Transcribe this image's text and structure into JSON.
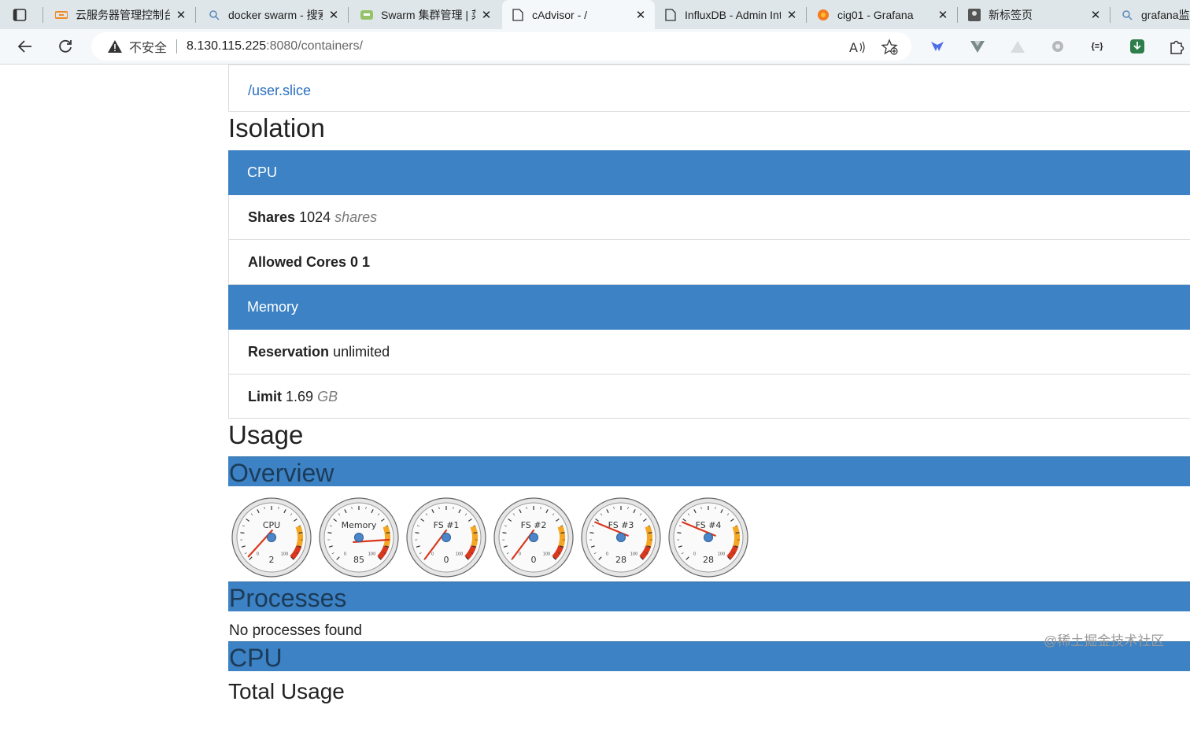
{
  "browser": {
    "tabs": [
      {
        "title": "云服务器管理控制台",
        "icon": "aliyun-icon",
        "close": "✕"
      },
      {
        "title": "docker swarm - 搜索",
        "icon": "search-icon",
        "close": "✕"
      },
      {
        "title": "Swarm 集群管理 | 菜鸟",
        "icon": "runoob-icon",
        "close": "✕"
      },
      {
        "title": "cAdvisor - /",
        "icon": "page-icon",
        "close": "✕"
      },
      {
        "title": "InfluxDB - Admin Interface",
        "icon": "page-icon",
        "close": "✕"
      },
      {
        "title": "cig01 - Grafana",
        "icon": "grafana-icon",
        "close": "✕"
      },
      {
        "title": "新标签页",
        "icon": "newtab-icon",
        "close": "✕"
      },
      {
        "title": "grafana监控",
        "icon": "search-icon",
        "close": ""
      }
    ],
    "security_label": "不安全",
    "url_host": "8.130.115.225",
    "url_rest": ":8080/containers/",
    "extensions": [
      "extension-blue-icon",
      "extension-vue-icon",
      "extension-triangle-icon",
      "extension-gear-icon",
      "extension-json-icon",
      "extension-download-icon",
      "extensions-puzzle-icon"
    ],
    "json_ext_label": "{≡}"
  },
  "page": {
    "subcontainer_link": "/user.slice",
    "isolation_title": "Isolation",
    "cpu_panel": {
      "heading": "CPU",
      "shares_label": "Shares",
      "shares_value": "1024",
      "shares_unit": "shares",
      "cores_label": "Allowed Cores",
      "cores_value": "0 1"
    },
    "memory_panel": {
      "heading": "Memory",
      "reservation_label": "Reservation",
      "reservation_value": "unlimited",
      "limit_label": "Limit",
      "limit_value": "1.69",
      "limit_unit": "GB"
    },
    "usage_title": "Usage",
    "overview_heading": "Overview",
    "gauges": [
      {
        "label": "CPU",
        "value": 2,
        "min_label": "0",
        "max_label": "100"
      },
      {
        "label": "Memory",
        "value": 85,
        "min_label": "0",
        "max_label": "100"
      },
      {
        "label": "FS #1",
        "value": 0,
        "min_label": "0",
        "max_label": "100"
      },
      {
        "label": "FS #2",
        "value": 0,
        "min_label": "0",
        "max_label": "100"
      },
      {
        "label": "FS #3",
        "value": 28,
        "min_label": "0",
        "max_label": "100"
      },
      {
        "label": "FS #4",
        "value": 28,
        "min_label": "0",
        "max_label": "100"
      }
    ],
    "processes_heading": "Processes",
    "processes_empty": "No processes found",
    "cpu_heading": "CPU",
    "total_usage_title": "Total Usage"
  },
  "watermark": "@稀土掘金技术社区",
  "colors": {
    "panel_blue": "#3c82c4",
    "link": "#2a6fc0",
    "gauge_red": "#d9381e",
    "gauge_orange": "#f5a623",
    "needle": "#d9381e",
    "hub": "#4a86c8"
  }
}
